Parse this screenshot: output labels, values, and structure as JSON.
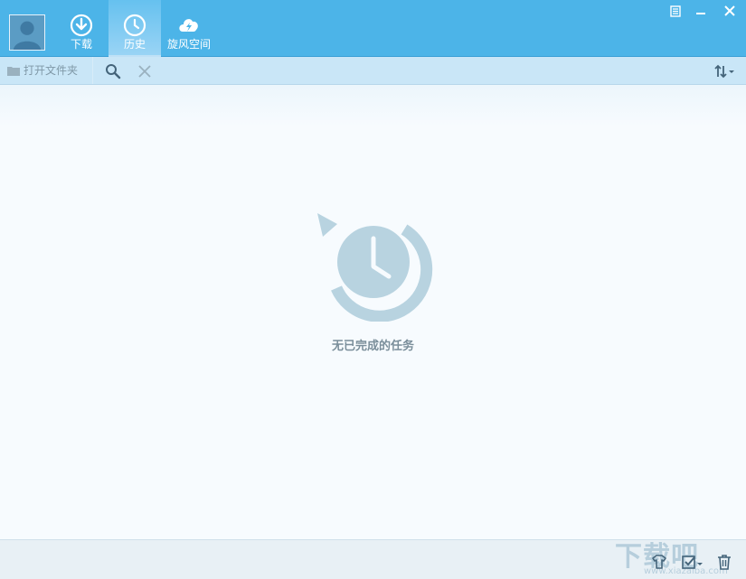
{
  "tabs": [
    {
      "label": "下载",
      "icon": "download-icon",
      "active": false
    },
    {
      "label": "历史",
      "icon": "history-icon",
      "active": true
    },
    {
      "label": "旋风空间",
      "icon": "cloud-space-icon",
      "active": false
    }
  ],
  "toolbar": {
    "open_folder_label": "打开文件夹"
  },
  "empty_state": {
    "message": "无已完成的任务"
  },
  "watermark": {
    "big": "下载吧",
    "small": "www.xiazaiba.com"
  },
  "colors": {
    "header": "#4cb4e8",
    "toolbar": "#c9e6f7",
    "content": "#f7fbfe",
    "icon_muted": "#b8d3e0",
    "footer": "#e8f0f5"
  }
}
